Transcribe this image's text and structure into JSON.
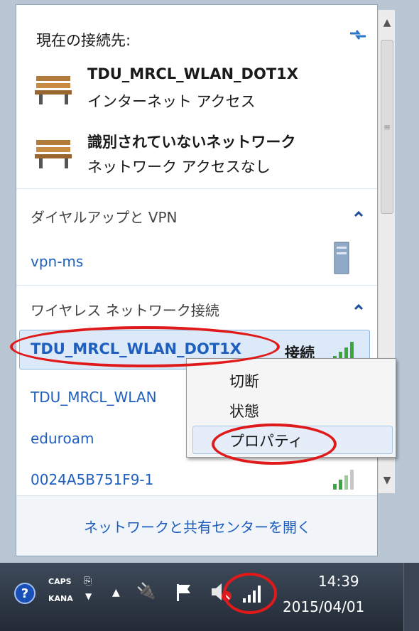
{
  "panel": {
    "current_label": "現在の接続先:",
    "connections": [
      {
        "name": "TDU_MRCL_WLAN_DOT1X",
        "status": "インターネット アクセス"
      },
      {
        "name": "識別されていないネットワーク",
        "status": "ネットワーク アクセスなし"
      }
    ],
    "dialup_header": "ダイヤルアップと VPN",
    "vpn_item": "vpn-ms",
    "wireless_header": "ワイヤレス ネットワーク接続",
    "wifi": [
      {
        "name": "TDU_MRCL_WLAN_DOT1X",
        "status": "接続"
      },
      {
        "name": "TDU_MRCL_WLAN"
      },
      {
        "name": "eduroam"
      },
      {
        "name": "0024A5B751F9-1"
      }
    ],
    "footer_link": "ネットワークと共有センターを開く"
  },
  "context_menu": {
    "items": [
      "切断",
      "状態",
      "プロパティ"
    ]
  },
  "taskbar": {
    "caps": "CAPS",
    "kana": "KANA",
    "time": "14:39",
    "date": "2015/04/01"
  },
  "colors": {
    "link": "#1f5fbf",
    "highlight_oval": "#e01a1a",
    "signal": "#3aa83a"
  }
}
